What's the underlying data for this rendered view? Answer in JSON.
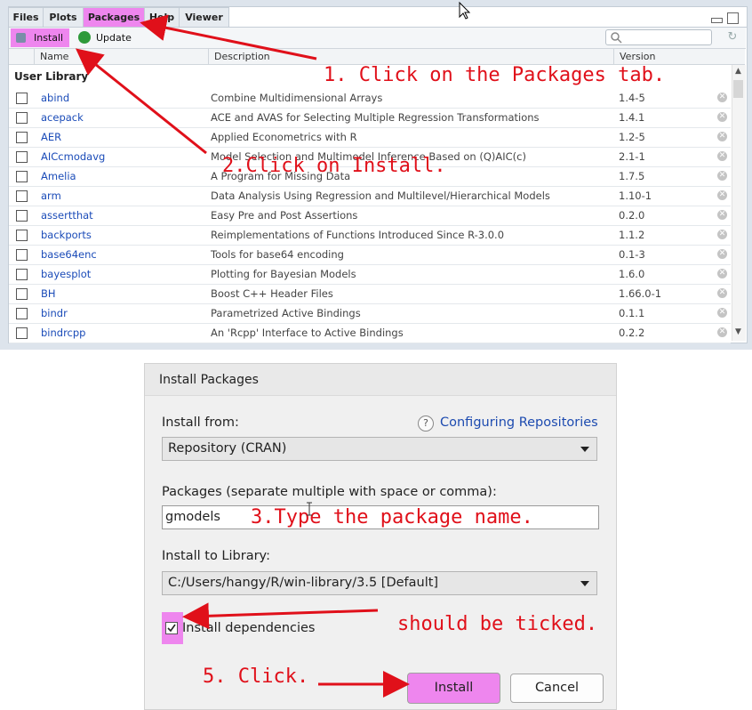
{
  "pane": {
    "tabs": [
      "Files",
      "Plots",
      "Packages",
      "Help",
      "Viewer"
    ],
    "active_tab": "Packages",
    "toolbar": {
      "install_label": "Install",
      "update_label": "Update",
      "search_value": ""
    },
    "columns": {
      "name": "Name",
      "description": "Description",
      "version": "Version"
    },
    "section_label": "User Library",
    "packages": [
      {
        "name": "abind",
        "description": "Combine Multidimensional Arrays",
        "version": "1.4-5"
      },
      {
        "name": "acepack",
        "description": "ACE and AVAS for Selecting Multiple Regression Transformations",
        "version": "1.4.1"
      },
      {
        "name": "AER",
        "description": "Applied Econometrics with R",
        "version": "1.2-5"
      },
      {
        "name": "AICcmodavg",
        "description": "Model Selection and Multimodel Inference Based on (Q)AIC(c)",
        "version": "2.1-1"
      },
      {
        "name": "Amelia",
        "description": "A Program for Missing Data",
        "version": "1.7.5"
      },
      {
        "name": "arm",
        "description": "Data Analysis Using Regression and Multilevel/Hierarchical Models",
        "version": "1.10-1"
      },
      {
        "name": "assertthat",
        "description": "Easy Pre and Post Assertions",
        "version": "0.2.0"
      },
      {
        "name": "backports",
        "description": "Reimplementations of Functions Introduced Since R-3.0.0",
        "version": "1.1.2"
      },
      {
        "name": "base64enc",
        "description": "Tools for base64 encoding",
        "version": "0.1-3"
      },
      {
        "name": "bayesplot",
        "description": "Plotting for Bayesian Models",
        "version": "1.6.0"
      },
      {
        "name": "BH",
        "description": "Boost C++ Header Files",
        "version": "1.66.0-1"
      },
      {
        "name": "bindr",
        "description": "Parametrized Active Bindings",
        "version": "0.1.1"
      },
      {
        "name": "bindrcpp",
        "description": "An 'Rcpp' Interface to Active Bindings",
        "version": "0.2.2"
      }
    ]
  },
  "dialog": {
    "title": "Install Packages",
    "install_from_label": "Install from:",
    "help_link": "Configuring Repositories",
    "install_from_value": "Repository (CRAN)",
    "packages_label": "Packages (separate multiple with space or comma):",
    "packages_value": "gmodels",
    "library_label": "Install to Library:",
    "library_value": "C:/Users/hangy/R/win-library/3.5 [Default]",
    "dependencies_label": "Install dependencies",
    "dependencies_checked": true,
    "install_button": "Install",
    "cancel_button": "Cancel"
  },
  "annotations": {
    "step1": "1. Click on the Packages tab.",
    "step2": "2.Click on Install.",
    "step3": "3.Type the package name.",
    "step4": "should be ticked.",
    "step5": "5. Click."
  },
  "colors": {
    "highlight": "#ee86ee",
    "annotation": "#e0101a",
    "link": "#1a4bb8"
  }
}
